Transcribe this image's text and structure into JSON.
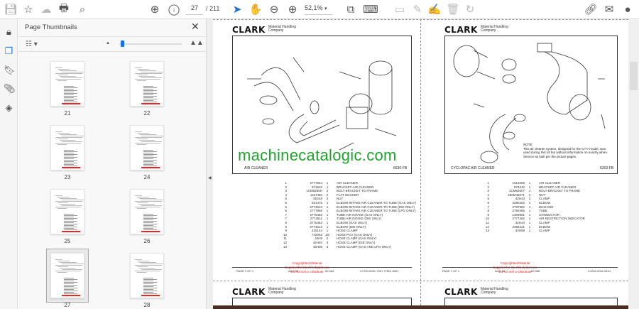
{
  "toolbar": {
    "page_current": "27",
    "page_total": "/ 211",
    "zoom_value": "52,1%"
  },
  "panel": {
    "title": "Page Thumbnails",
    "close": "✕"
  },
  "thumbnails": [
    {
      "label": "21"
    },
    {
      "label": "22"
    },
    {
      "label": "23"
    },
    {
      "label": "24"
    },
    {
      "label": "25"
    },
    {
      "label": "26"
    },
    {
      "label": "27",
      "selected": true
    },
    {
      "label": "28"
    }
  ],
  "watermark_site": "machinecatalogic.com",
  "pages": [
    {
      "logo": "CLARK",
      "company": "Material Handling Company",
      "caption": "AIR CLEANER",
      "code": "6630-FB",
      "parts": [
        [
          "1",
          "2777844",
          "1",
          "AIR CLEANER"
        ],
        [
          "2",
          "871610",
          "1",
          "BRACKET-AIR CLEANER"
        ],
        [
          "3",
          "1CM6250H",
          "2",
          "BOLT-BRACKET TO FRAME"
        ],
        [
          "4",
          "1167480",
          "2",
          "FLAT WASHER"
        ],
        [
          "5",
          "43G48",
          "2",
          "NUT"
        ],
        [
          "6",
          "821475",
          "1",
          "ELBOW-INTAKE AIR CLEANER TO TUBE (GAS ONLY)"
        ],
        [
          "6",
          "2774513",
          "1",
          "ELBOW-INTAKE AIR CLEANER TO TUBE (DIE ONLY)"
        ],
        [
          "6",
          "2777968",
          "1",
          "ELBOW-INTAKE AIR CLEANER TO TUBE (LPG ONLY)"
        ],
        [
          "7",
          "2775483",
          "1",
          "TUBE-AIR INTAKE (GAS ONLY)"
        ],
        [
          "7",
          "2774511",
          "1",
          "TUBE-AIR INTAKE (DIE ONLY)"
        ],
        [
          "8",
          "2775464",
          "1",
          "ELBOW (GAS ONLY)"
        ],
        [
          "8",
          "2774513",
          "1",
          "ELBOW (DIE ONLY)"
        ],
        [
          "9",
          "425144",
          "1",
          "HOSE CLAMP"
        ],
        [
          "10",
          "742063",
          ".25'",
          "HOSE-PCV (GAS ONLY)"
        ],
        [
          "11",
          "42H9",
          "2",
          "HOSE CLAMP (GAS ONLY)"
        ],
        [
          "12",
          "42H40",
          "3",
          "HOSE CLAMP (DIE ONLY)"
        ],
        [
          "13",
          "43H06",
          "3",
          "HOSE CLAMP (GAS AND LPG ONLY)"
        ]
      ],
      "footer": {
        "page": "PAGE 1 OF 1",
        "date": "AUG 96",
        "num": "60.364",
        "serial": "C1750-0001-7001 THRU 8001"
      }
    },
    {
      "logo": "CLARK",
      "company": "Material Handling Company",
      "caption": "CYCLOPAC AIR CLEANER",
      "code": "6263-FB",
      "note_title": "NOTE:",
      "note": "This air cleaner system, designed for the C/T? model, was used during this lot but without information on exactly when. Service as built per the picture pages.",
      "parts": [
        [
          "1",
          "1913458",
          "1",
          "AIR CLEANER"
        ],
        [
          "2",
          "874410",
          "1",
          "BRACKET-AIR CLEANER"
        ],
        [
          "3",
          "1CM62507",
          "4",
          "BOLT-BRACKET TO FRAME"
        ],
        [
          "4",
          "450M48271",
          "2",
          "NUT"
        ],
        [
          "5",
          "42H43",
          "2",
          "CLAMP"
        ],
        [
          "6",
          "2396402",
          "1",
          "ELBOW"
        ],
        [
          "7",
          "2797962",
          "1",
          "BUSHING"
        ],
        [
          "8",
          "2792466",
          "1",
          "TUBE"
        ],
        [
          "9",
          "1309991",
          "1",
          "CONNECTOR"
        ],
        [
          "10",
          "2777462",
          "1",
          "AIR RESTRICTION INDICATOR"
        ],
        [
          "11",
          "42H43",
          "1",
          "CLAMP"
        ],
        [
          "12",
          "2396421",
          "1",
          "ELBOW"
        ],
        [
          "13",
          "42H58",
          "1",
          "CLAMP"
        ]
      ],
      "footer": {
        "page": "PAGE 1 OF 1",
        "date": "AUG 96",
        "num": "60.365",
        "serial": "C1250-0001-6101"
      }
    }
  ],
  "copyright": [
    "Copyrighted Material",
    "Supplied for CLARK dealer use",
    "Do not sell or distribute"
  ],
  "next_pages": [
    {
      "logo": "CLARK",
      "company": "Material Handling Company"
    },
    {
      "logo": "CLARK",
      "company": "Material Handling Company"
    }
  ]
}
